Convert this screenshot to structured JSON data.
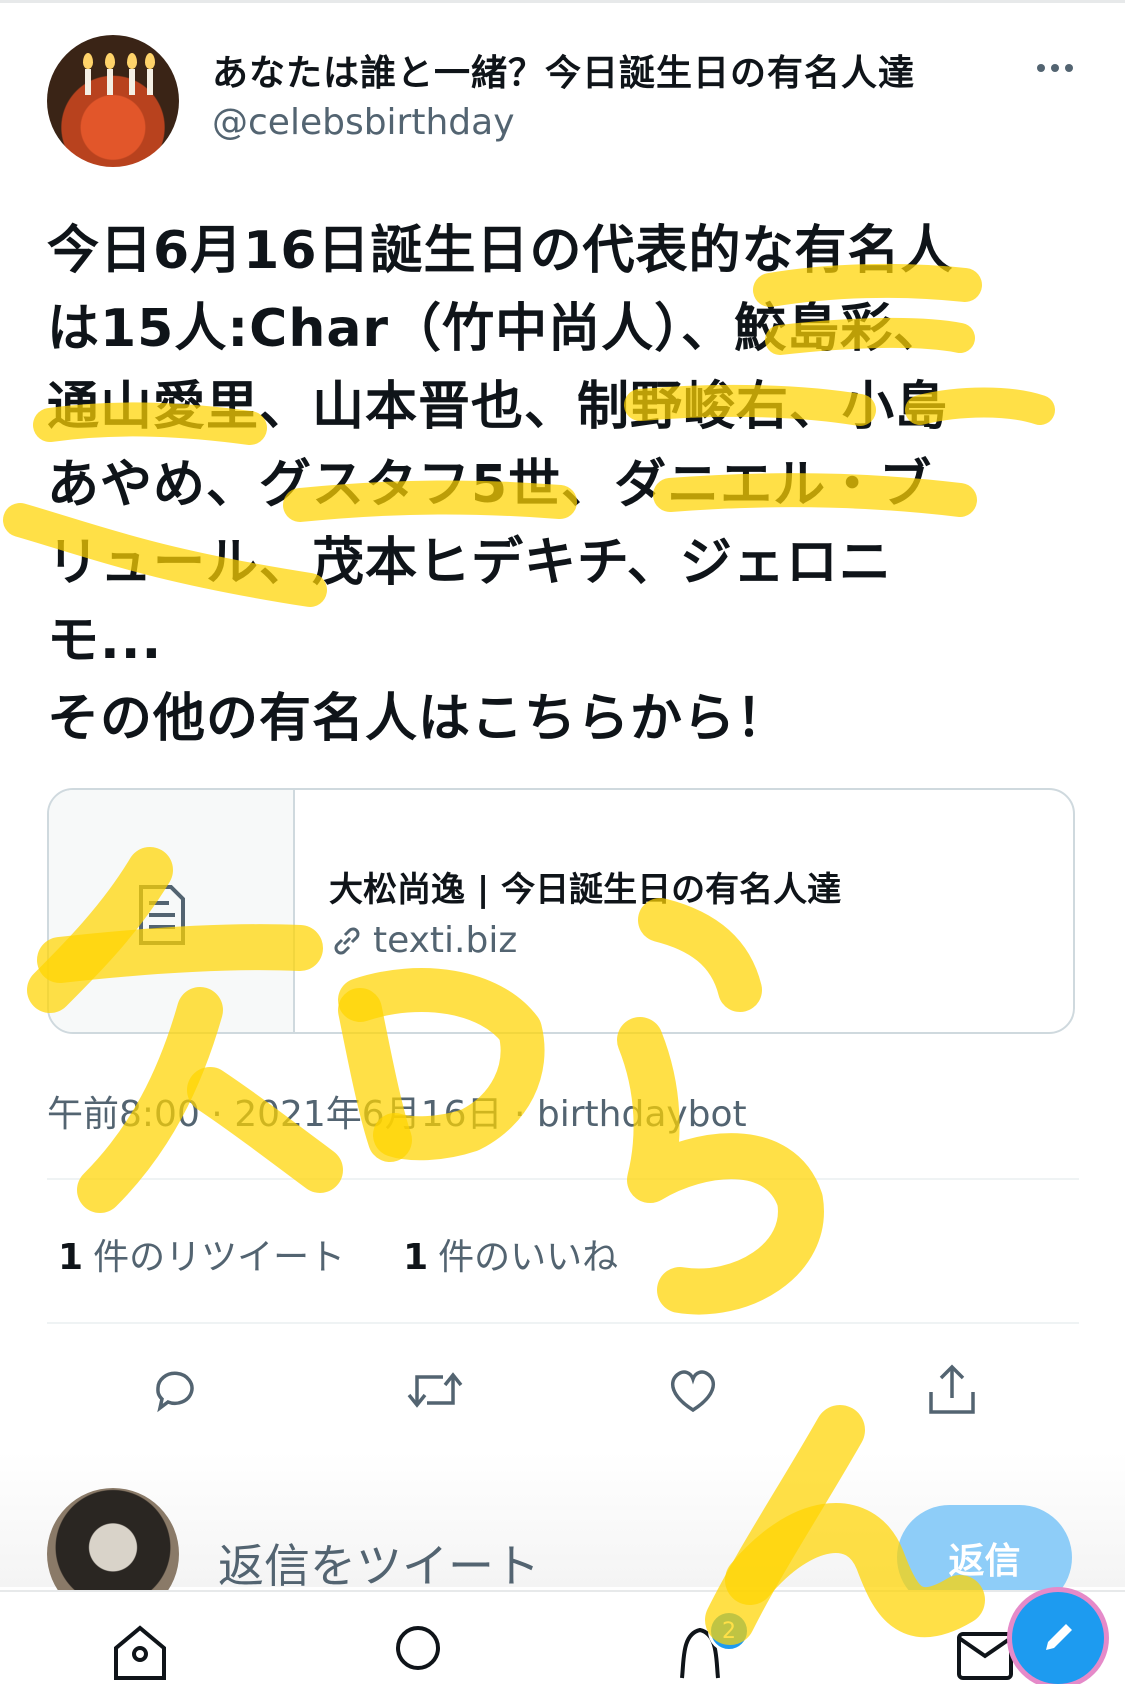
{
  "header": {
    "account_name": "あなたは誰と一緒？今日誕生日の有名人達",
    "account_handle": "@celebsbirthday"
  },
  "tweet": {
    "text": "今日6月16日誕生日の代表的な有名人\nは15人:Char（竹中尚人）、鮫島彩、\n通山愛里、山本晋也、制野峻右、小島\nあやめ、グスタフ5世、ダニエル・ブ\nリュール、茂本ヒデキチ、ジェロニ\nモ...\nその他の有名人はこちらから！"
  },
  "card": {
    "title": "大松尚逸 | 今日誕生日の有名人達",
    "domain": "texti.biz",
    "thumbnail_icon": "document-icon",
    "domain_icon": "link-icon"
  },
  "meta": {
    "time": "午前8:00",
    "date": "2021年6月16日",
    "source": "birthdaybot"
  },
  "stats": {
    "retweets_count": "1",
    "retweets_label": "件のリツイート",
    "likes_count": "1",
    "likes_label": "件のいいね"
  },
  "actions": [
    "reply-icon",
    "retweet-icon",
    "like-icon",
    "share-icon"
  ],
  "reply": {
    "placeholder": "返信をツイート",
    "button_label": "返信"
  },
  "nav": {
    "items": [
      "home-icon",
      "search-icon",
      "notifications-icon",
      "messages-icon"
    ],
    "notifications_badge": "2",
    "compose_icon": "compose-icon"
  },
  "overlay": {
    "handwriting": "知らん",
    "marker_color": "#ffd400"
  },
  "colors": {
    "text": "#0f1419",
    "secondary": "#536471",
    "accent": "#1d9bf0",
    "reply_button": "#8ecdf8"
  }
}
